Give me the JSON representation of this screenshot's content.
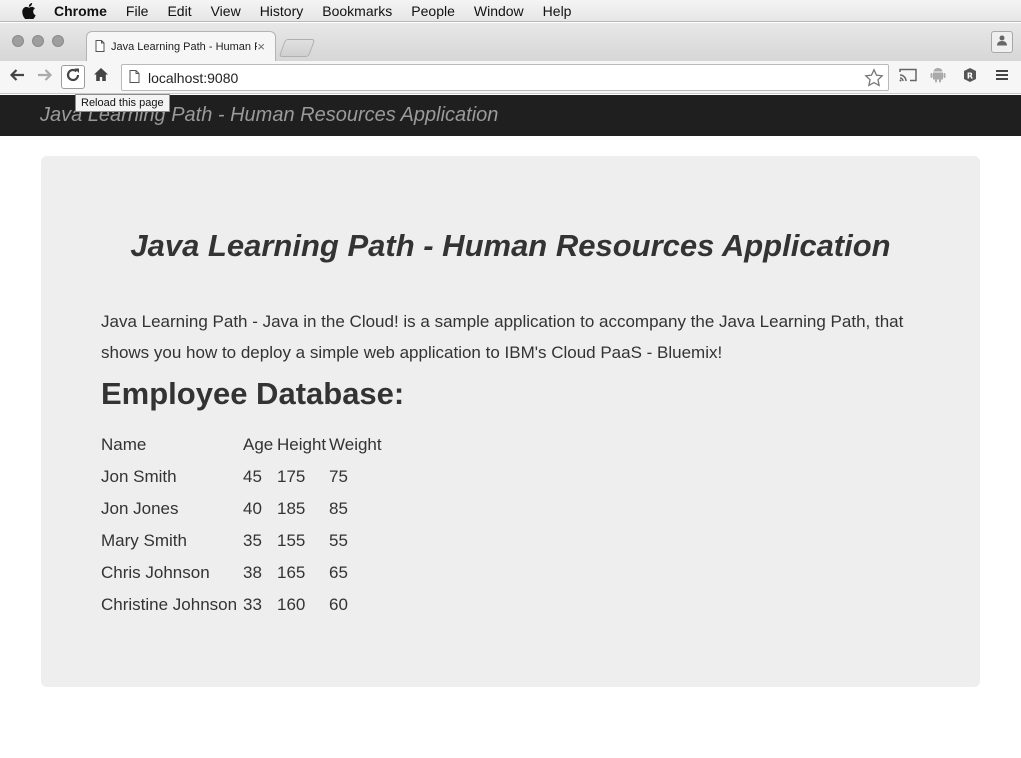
{
  "menubar": {
    "app_name": "Chrome",
    "items": [
      "File",
      "Edit",
      "View",
      "History",
      "Bookmarks",
      "People",
      "Window",
      "Help"
    ]
  },
  "browser": {
    "tab_title": "Java Learning Path - Human Resources Application",
    "tab_close": "×",
    "url": "localhost:9080",
    "reload_tooltip": "Reload this page"
  },
  "app": {
    "navbar_brand": "Java Learning Path - Human Resources Application",
    "jumbotron_title": "Java Learning Path - Human Resources Application",
    "description": "Java Learning Path - Java in the Cloud! is a sample application to accompany the Java Learning Path, that shows you how to deploy a simple web application to IBM's Cloud PaaS - Bluemix!",
    "section_title": "Employee Database:",
    "table": {
      "headers": [
        "Name",
        "Age",
        "Height",
        "Weight"
      ],
      "rows": [
        [
          "Jon Smith",
          "45",
          "175",
          "75"
        ],
        [
          "Jon Jones",
          "40",
          "185",
          "85"
        ],
        [
          "Mary Smith",
          "35",
          "155",
          "55"
        ],
        [
          "Chris Johnson",
          "38",
          "165",
          "65"
        ],
        [
          "Christine Johnson",
          "33",
          "160",
          "60"
        ]
      ]
    }
  },
  "icons": {
    "menubar": "apple-icon",
    "tab": "page-icon",
    "toolbar": [
      "back-arrow-icon",
      "forward-arrow-icon",
      "reload-icon",
      "home-icon",
      "star-icon",
      "cast-icon",
      "android-icon",
      "extension-icon",
      "menu-icon"
    ]
  },
  "colors": {
    "navbar_bg": "#1f1f1f",
    "navbar_text": "#9a9a9a",
    "jumbotron_bg": "#eeeeee",
    "text": "#333333"
  }
}
